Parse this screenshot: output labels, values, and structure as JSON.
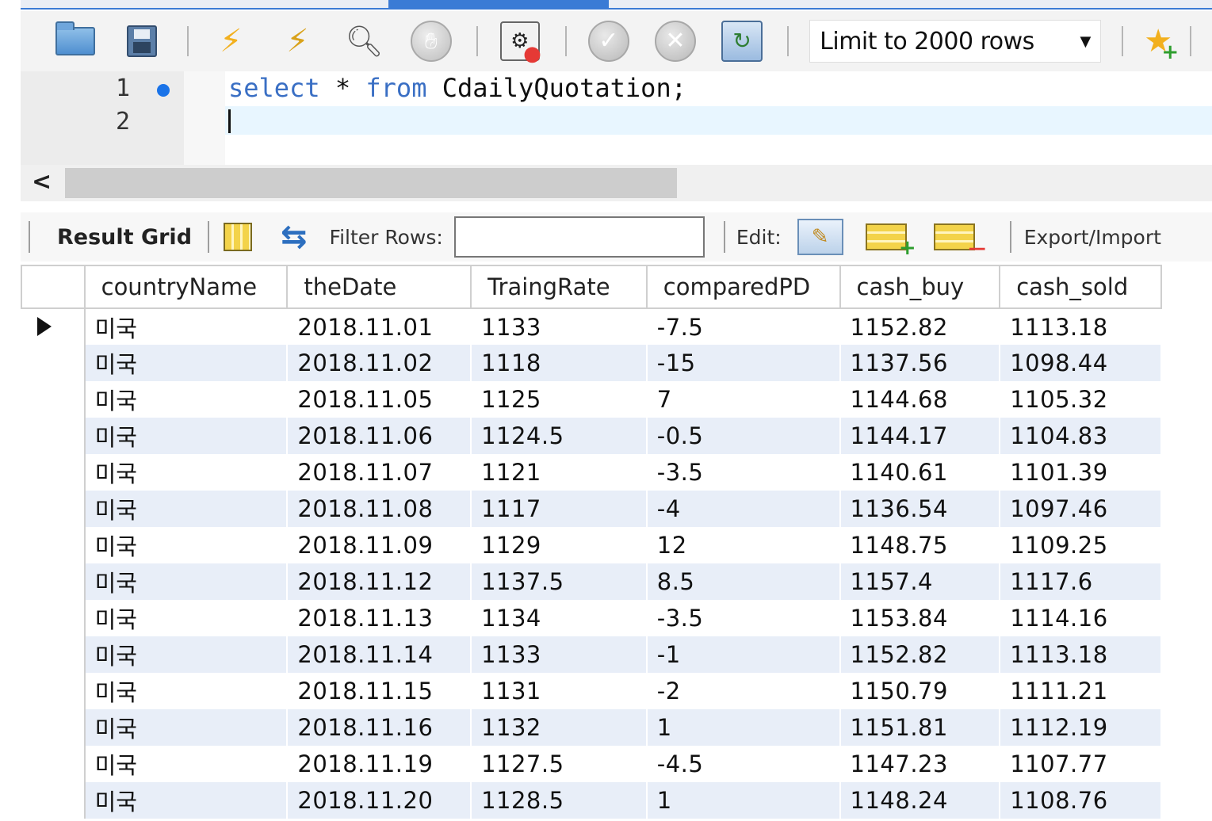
{
  "toolbar": {
    "limit_select_value": "Limit to 2000 rows"
  },
  "editor": {
    "line_numbers": [
      "1",
      "2"
    ],
    "line1_tokens": {
      "select": "select",
      "star": " * ",
      "from": "from",
      "rest": " CdailyQuotation;"
    }
  },
  "results_toolbar": {
    "result_grid_label": "Result Grid",
    "filter_label": "Filter Rows:",
    "filter_value": "",
    "edit_label": "Edit:",
    "export_label": "Export/Import"
  },
  "grid": {
    "columns": [
      "countryName",
      "theDate",
      "TraingRate",
      "comparedPD",
      "cash_buy",
      "cash_sold"
    ],
    "rows": [
      [
        "미국",
        "2018.11.01",
        "1133",
        "-7.5",
        "1152.82",
        "1113.18"
      ],
      [
        "미국",
        "2018.11.02",
        "1118",
        "-15",
        "1137.56",
        "1098.44"
      ],
      [
        "미국",
        "2018.11.05",
        "1125",
        "7",
        "1144.68",
        "1105.32"
      ],
      [
        "미국",
        "2018.11.06",
        "1124.5",
        "-0.5",
        "1144.17",
        "1104.83"
      ],
      [
        "미국",
        "2018.11.07",
        "1121",
        "-3.5",
        "1140.61",
        "1101.39"
      ],
      [
        "미국",
        "2018.11.08",
        "1117",
        "-4",
        "1136.54",
        "1097.46"
      ],
      [
        "미국",
        "2018.11.09",
        "1129",
        "12",
        "1148.75",
        "1109.25"
      ],
      [
        "미국",
        "2018.11.12",
        "1137.5",
        "8.5",
        "1157.4",
        "1117.6"
      ],
      [
        "미국",
        "2018.11.13",
        "1134",
        "-3.5",
        "1153.84",
        "1114.16"
      ],
      [
        "미국",
        "2018.11.14",
        "1133",
        "-1",
        "1152.82",
        "1113.18"
      ],
      [
        "미국",
        "2018.11.15",
        "1131",
        "-2",
        "1150.79",
        "1111.21"
      ],
      [
        "미국",
        "2018.11.16",
        "1132",
        "1",
        "1151.81",
        "1112.19"
      ],
      [
        "미국",
        "2018.11.19",
        "1127.5",
        "-4.5",
        "1147.23",
        "1107.77"
      ],
      [
        "미국",
        "2018.11.20",
        "1128.5",
        "1",
        "1148.24",
        "1108.76"
      ]
    ]
  }
}
